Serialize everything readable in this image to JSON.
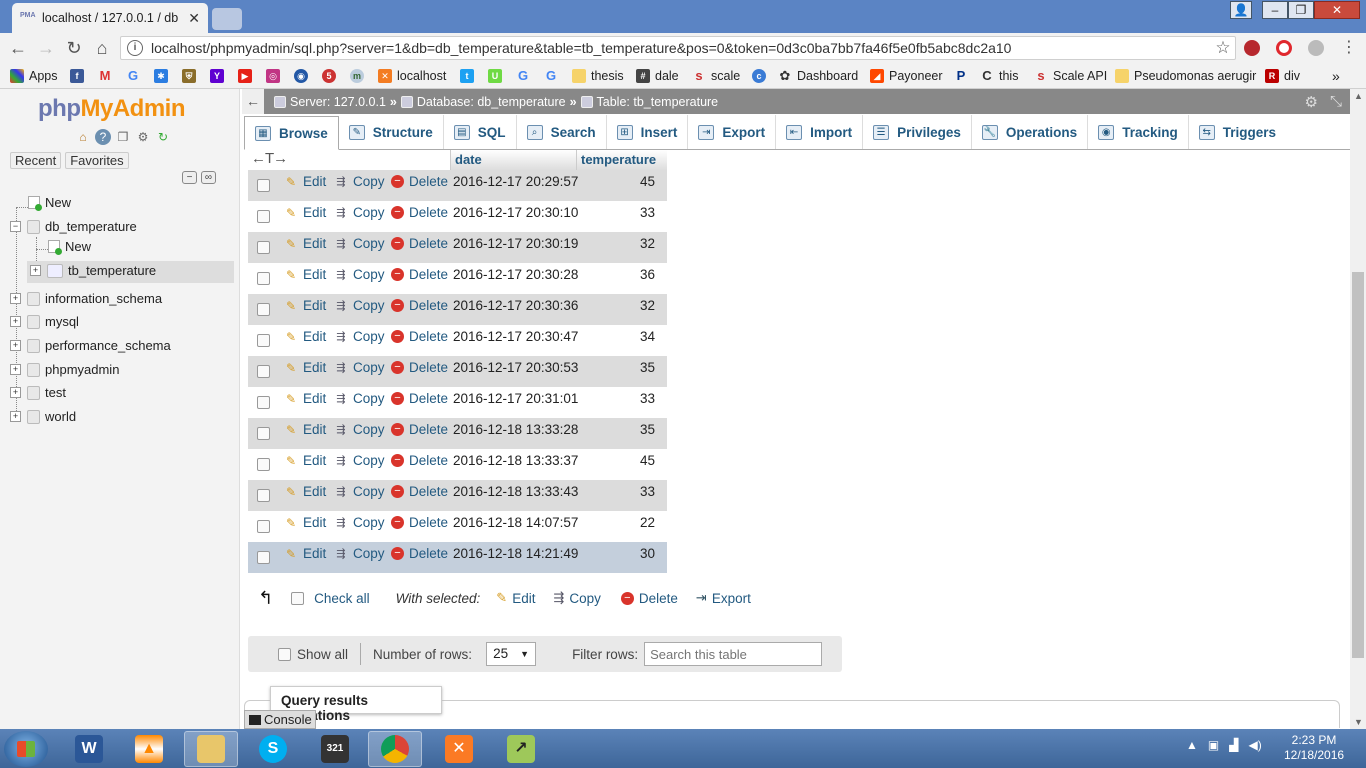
{
  "browser": {
    "tab_title": "localhost / 127.0.0.1 / db",
    "tab_favicon": "PMA",
    "url": "localhost/phpmyadmin/sql.php?server=1&db=db_temperature&table=tb_temperature&pos=0&token=0d3c0ba7bb7fa46f5e0fb5abc8dc2a10",
    "bookmarks": [
      "Apps",
      "localhost",
      "thesis",
      "dale",
      "scale",
      "Dashboard",
      "Payoneer",
      "this",
      "Scale API",
      "Pseudomonas aerugir",
      "div"
    ]
  },
  "sidebar": {
    "logo_php": "php",
    "logo_myadmin": "MyAdmin",
    "tab_recent": "Recent",
    "tab_favorites": "Favorites",
    "tree": {
      "new_top": "New",
      "db_temperature": "db_temperature",
      "new_child": "New",
      "tb_temperature": "tb_temperature",
      "information_schema": "information_schema",
      "mysql": "mysql",
      "performance_schema": "performance_schema",
      "phpmyadmin": "phpmyadmin",
      "test": "test",
      "world": "world"
    }
  },
  "breadcrumb": {
    "server": "Server: 127.0.0.1",
    "database": "Database: db_temperature",
    "table": "Table: tb_temperature"
  },
  "menu": {
    "browse": "Browse",
    "structure": "Structure",
    "sql": "SQL",
    "search": "Search",
    "insert": "Insert",
    "export": "Export",
    "import": "Import",
    "privileges": "Privileges",
    "operations": "Operations",
    "tracking": "Tracking",
    "triggers": "Triggers"
  },
  "table": {
    "columns": {
      "date": "date",
      "temperature": "temperature"
    },
    "actions": {
      "edit": "Edit",
      "copy": "Copy",
      "delete": "Delete"
    },
    "rows": [
      {
        "date": "2016-12-17 20:29:57",
        "temperature": "45"
      },
      {
        "date": "2016-12-17 20:30:10",
        "temperature": "33"
      },
      {
        "date": "2016-12-17 20:30:19",
        "temperature": "32"
      },
      {
        "date": "2016-12-17 20:30:28",
        "temperature": "36"
      },
      {
        "date": "2016-12-17 20:30:36",
        "temperature": "32"
      },
      {
        "date": "2016-12-17 20:30:47",
        "temperature": "34"
      },
      {
        "date": "2016-12-17 20:30:53",
        "temperature": "35"
      },
      {
        "date": "2016-12-17 20:31:01",
        "temperature": "33"
      },
      {
        "date": "2016-12-18 13:33:28",
        "temperature": "35"
      },
      {
        "date": "2016-12-18 13:33:37",
        "temperature": "45"
      },
      {
        "date": "2016-12-18 13:33:43",
        "temperature": "33"
      },
      {
        "date": "2016-12-18 14:07:57",
        "temperature": "22"
      },
      {
        "date": "2016-12-18 14:21:49",
        "temperature": "30"
      }
    ]
  },
  "bulk": {
    "check_all": "Check all",
    "with_selected": "With selected:",
    "edit": "Edit",
    "copy": "Copy",
    "delete": "Delete",
    "export": "Export"
  },
  "nav": {
    "show_all": "Show all",
    "number_of_rows_label": "Number of rows:",
    "number_of_rows_value": "25",
    "filter_label": "Filter rows:",
    "filter_placeholder": "Search this table"
  },
  "query_results_operations": "Query results operations",
  "console": "Console",
  "taskbar": {
    "time": "2:23 PM",
    "date": "12/18/2016"
  }
}
